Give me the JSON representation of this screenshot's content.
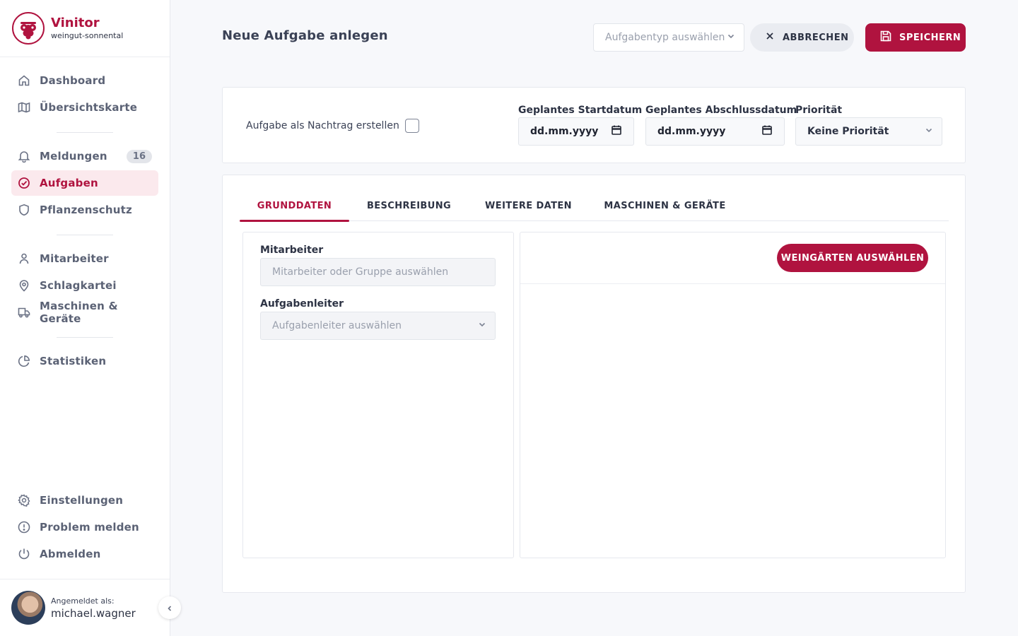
{
  "brand": {
    "name": "Vinitor",
    "tenant": "weingut-sonnental"
  },
  "nav": {
    "dashboard": "Dashboard",
    "map": "Übersichtskarte",
    "notifications": "Meldungen",
    "notifications_count": "16",
    "tasks": "Aufgaben",
    "plant_protection": "Pflanzenschutz",
    "employees": "Mitarbeiter",
    "field_index": "Schlagkartei",
    "machines": "Maschinen & Geräte",
    "statistics": "Statistiken",
    "settings": "Einstellungen",
    "report_problem": "Problem melden",
    "logout": "Abmelden"
  },
  "user": {
    "label": "Angemeldet als:",
    "name": "michael.wagner"
  },
  "header": {
    "title": "Neue Aufgabe anlegen",
    "task_type_placeholder": "Aufgabentyp auswählen",
    "cancel_label": "ABBRECHEN",
    "save_label": "SPEICHERN"
  },
  "options": {
    "supplement_label": "Aufgabe als Nachtrag erstellen",
    "start_date_label": "Geplantes Startdatum",
    "start_date_value": "dd.mm.yyyy",
    "end_date_label": "Geplantes Abschlussdatum",
    "end_date_value": "dd.mm.yyyy",
    "priority_label": "Priorität",
    "priority_value": "Keine Priorität"
  },
  "tabs": [
    "GRUNDDATEN",
    "BESCHREIBUNG",
    "WEITERE DATEN",
    "MASCHINEN & GERÄTE"
  ],
  "form": {
    "employees_label": "Mitarbeiter",
    "employees_placeholder": "Mitarbeiter oder Gruppe auswählen",
    "leader_label": "Aufgabenleiter",
    "leader_placeholder": "Aufgabenleiter auswählen",
    "select_vineyards": "WEINGÄRTEN AUSWÄHLEN"
  },
  "colors": {
    "accent": "#b0133f",
    "accent_light": "#fbe9ed"
  }
}
